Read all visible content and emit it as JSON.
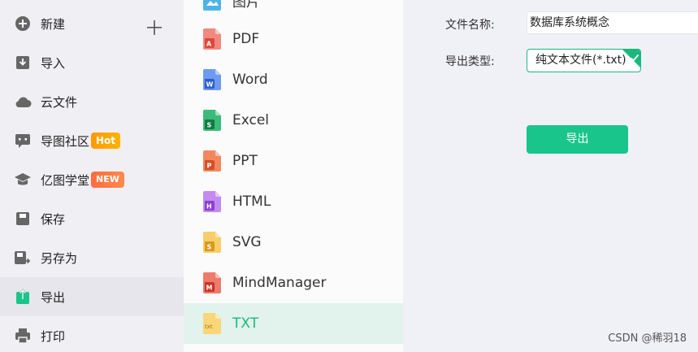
{
  "sidebar": {
    "items": [
      {
        "label": "新建",
        "icon": "plus-circle-icon"
      },
      {
        "label": "导入",
        "icon": "import-icon"
      },
      {
        "label": "云文件",
        "icon": "cloud-icon"
      },
      {
        "label": "导图社区",
        "icon": "community-icon",
        "badge": "Hot"
      },
      {
        "label": "亿图学堂",
        "icon": "graduation-cap-icon",
        "badge": "NEW"
      },
      {
        "label": "保存",
        "icon": "save-icon"
      },
      {
        "label": "另存为",
        "icon": "save-as-icon"
      },
      {
        "label": "导出",
        "icon": "export-icon"
      },
      {
        "label": "打印",
        "icon": "printer-icon"
      }
    ]
  },
  "formats": {
    "partial_top": "图片",
    "items": [
      {
        "label": "PDF",
        "icon": "pdf-file-icon",
        "color": "#e8574b"
      },
      {
        "label": "Word",
        "icon": "word-file-icon",
        "color": "#3f72d8"
      },
      {
        "label": "Excel",
        "icon": "excel-file-icon",
        "color": "#1f9e5f"
      },
      {
        "label": "PPT",
        "icon": "ppt-file-icon",
        "color": "#ea6a3d"
      },
      {
        "label": "HTML",
        "icon": "html-file-icon",
        "color": "#a155e0"
      },
      {
        "label": "SVG",
        "icon": "svg-file-icon",
        "color": "#f0b431"
      },
      {
        "label": "MindManager",
        "icon": "mindmanager-file-icon",
        "color": "#e04a3a"
      },
      {
        "label": "TXT",
        "icon": "txt-file-icon",
        "color": "#f3c23c"
      }
    ],
    "selected": "TXT"
  },
  "form": {
    "file_name_label": "文件名称:",
    "file_name_value": "数据库系统概念",
    "export_type_label": "导出类型:",
    "export_type_value": "纯文本文件(*.txt)",
    "export_button": "导出"
  },
  "watermark": "CSDN @稀羽18",
  "colors": {
    "accent": "#19c58b",
    "selected_bg": "#e2f2ec"
  }
}
